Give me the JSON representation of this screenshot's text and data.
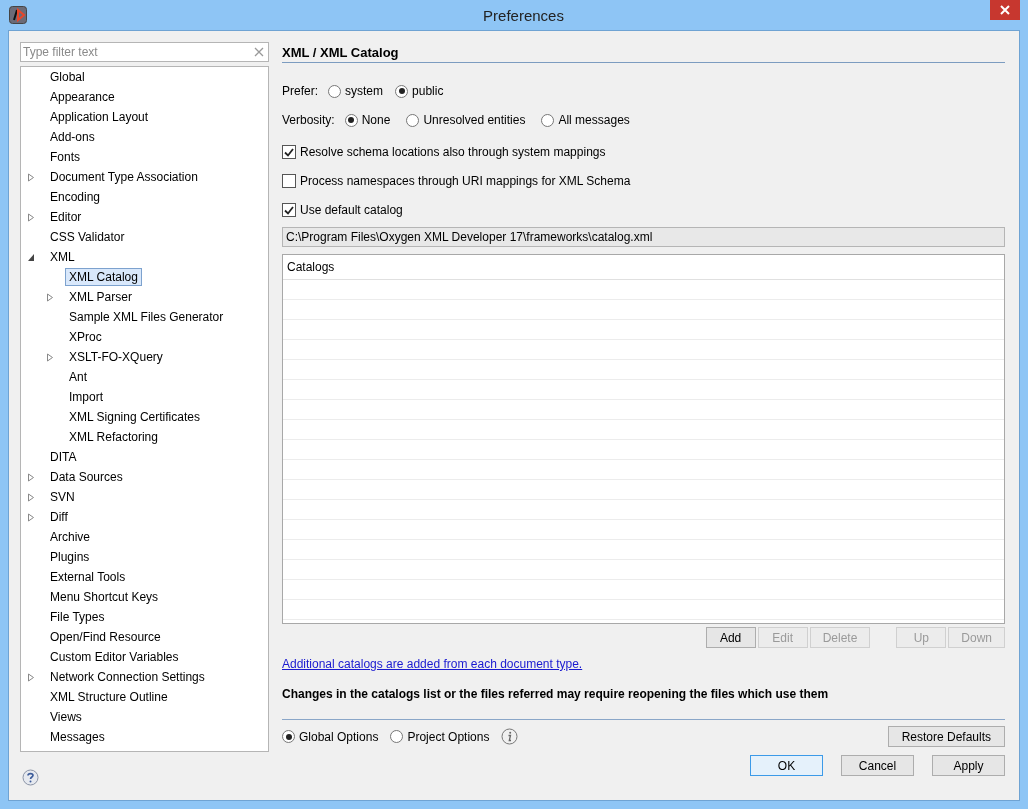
{
  "window": {
    "title": "Preferences"
  },
  "filter": {
    "placeholder": "Type filter text"
  },
  "tree": [
    {
      "label": "Global",
      "expandable": false,
      "selected": false
    },
    {
      "label": "Appearance",
      "expandable": false,
      "selected": false
    },
    {
      "label": "Application Layout",
      "expandable": false,
      "selected": false
    },
    {
      "label": "Add-ons",
      "expandable": false,
      "selected": false
    },
    {
      "label": "Fonts",
      "expandable": false,
      "selected": false
    },
    {
      "label": "Document Type Association",
      "expandable": true,
      "expanded": false,
      "selected": false
    },
    {
      "label": "Encoding",
      "expandable": false,
      "selected": false
    },
    {
      "label": "Editor",
      "expandable": true,
      "expanded": false,
      "selected": false
    },
    {
      "label": "CSS Validator",
      "expandable": false,
      "selected": false
    },
    {
      "label": "XML",
      "expandable": true,
      "expanded": true,
      "selected": false,
      "children": [
        {
          "label": "XML Catalog",
          "expandable": false,
          "selected": true
        },
        {
          "label": "XML Parser",
          "expandable": true,
          "expanded": false,
          "selected": false
        },
        {
          "label": "Sample XML Files Generator",
          "expandable": false,
          "selected": false
        },
        {
          "label": "XProc",
          "expandable": false,
          "selected": false
        },
        {
          "label": "XSLT-FO-XQuery",
          "expandable": true,
          "expanded": false,
          "selected": false
        },
        {
          "label": "Ant",
          "expandable": false,
          "selected": false
        },
        {
          "label": "Import",
          "expandable": false,
          "selected": false
        },
        {
          "label": "XML Signing Certificates",
          "expandable": false,
          "selected": false
        },
        {
          "label": "XML Refactoring",
          "expandable": false,
          "selected": false
        }
      ]
    },
    {
      "label": "DITA",
      "expandable": false,
      "selected": false
    },
    {
      "label": "Data Sources",
      "expandable": true,
      "expanded": false,
      "selected": false
    },
    {
      "label": "SVN",
      "expandable": true,
      "expanded": false,
      "selected": false
    },
    {
      "label": "Diff",
      "expandable": true,
      "expanded": false,
      "selected": false
    },
    {
      "label": "Archive",
      "expandable": false,
      "selected": false
    },
    {
      "label": "Plugins",
      "expandable": false,
      "selected": false
    },
    {
      "label": "External Tools",
      "expandable": false,
      "selected": false
    },
    {
      "label": "Menu Shortcut Keys",
      "expandable": false,
      "selected": false
    },
    {
      "label": "File Types",
      "expandable": false,
      "selected": false
    },
    {
      "label": "Open/Find Resource",
      "expandable": false,
      "selected": false
    },
    {
      "label": "Custom Editor Variables",
      "expandable": false,
      "selected": false
    },
    {
      "label": "Network Connection Settings",
      "expandable": true,
      "expanded": false,
      "selected": false
    },
    {
      "label": "XML Structure Outline",
      "expandable": false,
      "selected": false
    },
    {
      "label": "Views",
      "expandable": false,
      "selected": false
    },
    {
      "label": "Messages",
      "expandable": false,
      "selected": false
    }
  ],
  "page": {
    "heading": "XML / XML Catalog",
    "prefer": {
      "label": "Prefer:",
      "options": [
        {
          "label": "system",
          "selected": false
        },
        {
          "label": "public",
          "selected": true
        }
      ]
    },
    "verbosity": {
      "label": "Verbosity:",
      "options": [
        {
          "label": "None",
          "selected": true
        },
        {
          "label": "Unresolved entities",
          "selected": false
        },
        {
          "label": "All messages",
          "selected": false
        }
      ]
    },
    "checkboxes": [
      {
        "label": "Resolve schema locations also through system mappings",
        "checked": true
      },
      {
        "label": "Process namespaces through URI mappings for XML Schema",
        "checked": false
      },
      {
        "label": "Use default catalog",
        "checked": true
      }
    ],
    "default_catalog_path": "C:\\Program Files\\Oxygen XML Developer 17\\frameworks\\catalog.xml",
    "table": {
      "columns": [
        "Catalogs"
      ]
    },
    "table_buttons": [
      {
        "label": "Add",
        "disabled": false
      },
      {
        "label": "Edit",
        "disabled": true
      },
      {
        "label": "Delete",
        "disabled": true
      },
      {
        "label": "Up",
        "disabled": true
      },
      {
        "label": "Down",
        "disabled": true
      }
    ],
    "link": "Additional catalogs are added from each document type.",
    "note": "Changes in the catalogs list or the files referred may require reopening the files which use them",
    "scope": [
      {
        "label": "Global Options",
        "selected": true
      },
      {
        "label": "Project Options",
        "selected": false
      }
    ],
    "restore_button": "Restore Defaults"
  },
  "buttons": [
    {
      "label": "OK",
      "default": true
    },
    {
      "label": "Cancel",
      "default": false
    },
    {
      "label": "Apply",
      "default": false
    }
  ]
}
